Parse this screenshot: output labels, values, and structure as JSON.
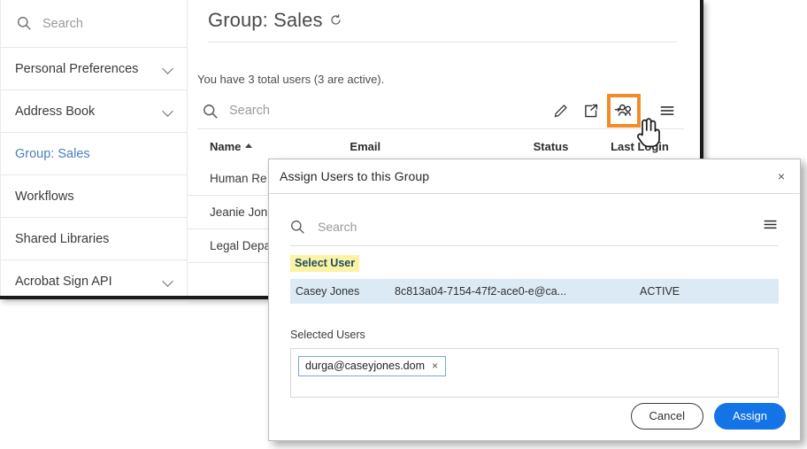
{
  "sidebar": {
    "search": {
      "placeholder": "Search",
      "icon": "search-icon"
    },
    "items": [
      {
        "label": "Personal Preferences",
        "has_chevron": true,
        "active": false
      },
      {
        "label": "Address Book",
        "has_chevron": true,
        "active": false
      },
      {
        "label": "Group: Sales",
        "has_chevron": false,
        "active": true
      },
      {
        "label": "Workflows",
        "has_chevron": false,
        "active": false
      },
      {
        "label": "Shared Libraries",
        "has_chevron": false,
        "active": false
      },
      {
        "label": "Acrobat Sign API",
        "has_chevron": true,
        "active": false
      }
    ]
  },
  "main": {
    "title": "Group: Sales",
    "title_icon": "refresh-icon",
    "user_count_text": "You have 3 total users (3 are active).",
    "toolbar": {
      "search_placeholder": "Search",
      "icons": [
        {
          "name": "edit-pencil-icon",
          "highlighted": false
        },
        {
          "name": "share-export-icon",
          "highlighted": false
        },
        {
          "name": "assign-users-icon",
          "highlighted": true
        },
        {
          "name": "hamburger-menu-icon",
          "highlighted": false
        }
      ],
      "highlight_color": "#F28C28"
    },
    "table": {
      "columns": [
        "Name",
        "Email",
        "Status",
        "Last Login"
      ],
      "sort_column": "Name",
      "sort_direction": "asc",
      "rows": [
        {
          "name": "Human Re",
          "email": "",
          "status": "",
          "last_login": ""
        },
        {
          "name": "Jeanie Jon",
          "email": "",
          "status": "",
          "last_login": ""
        },
        {
          "name": "Legal Depa",
          "email": "",
          "status": "",
          "last_login": ""
        }
      ]
    }
  },
  "modal": {
    "title": "Assign Users to this Group",
    "close_label": "×",
    "search_placeholder": "Search",
    "list_menu_icon": "hamburger-menu-icon",
    "select_user_label": "Select User",
    "select_user_highlight_color": "#FBF3A4",
    "result": {
      "name": "Casey Jones",
      "email": "8c813a04-7154-47f2-ace0-e@ca...",
      "status": "ACTIVE"
    },
    "selected_users_label": "Selected Users",
    "chips": [
      {
        "text": "durga@caseyjones.dom",
        "remove_label": "×"
      }
    ],
    "buttons": {
      "cancel": "Cancel",
      "assign": "Assign",
      "assign_color": "#1473E6"
    }
  }
}
